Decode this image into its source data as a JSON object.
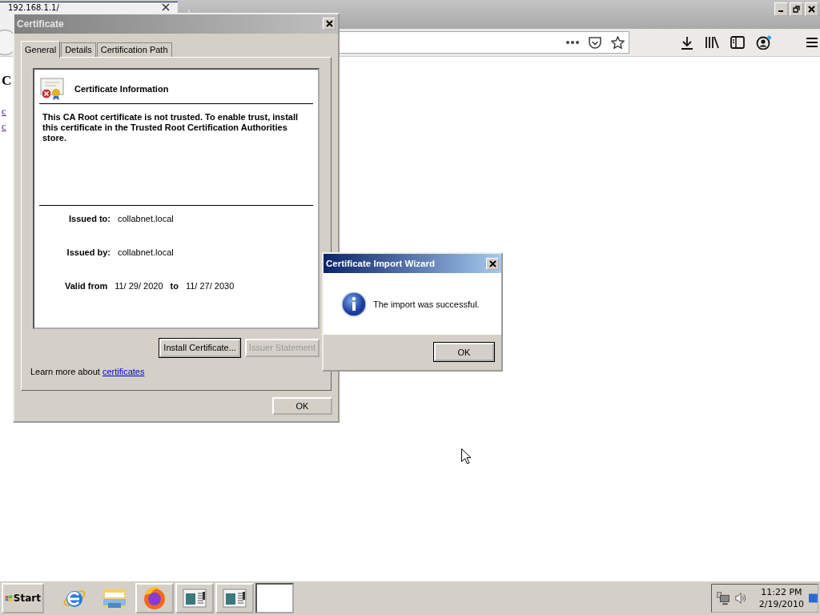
{
  "browser": {
    "tab": {
      "title": "192.168.1.1/"
    },
    "page": {
      "heading": "C",
      "links": [
        "c",
        "c"
      ]
    }
  },
  "certificate_dialog": {
    "title": "Certificate",
    "tabs": [
      {
        "label": "General",
        "selected": true
      },
      {
        "label": "Details",
        "selected": false
      },
      {
        "label": "Certification Path",
        "selected": false
      }
    ],
    "info_title": "Certificate Information",
    "message": "This CA Root certificate is not trusted. To enable trust, install this certificate in the Trusted Root Certification Authorities store.",
    "fields": [
      {
        "label": "Issued to:",
        "value": "collabnet.local"
      },
      {
        "label": "Issued by:",
        "value": "collabnet.local"
      }
    ],
    "validity": {
      "label": "Valid from",
      "from": "11/ 29/ 2020",
      "to_label": "to",
      "to": "11/ 27/ 2030"
    },
    "buttons": [
      {
        "label": "Install Certificate...",
        "disabled": false
      },
      {
        "label": "Issuer Statement",
        "disabled": true
      }
    ],
    "learn_more": {
      "text": "Learn more about",
      "link": "certificates"
    },
    "ok": "OK"
  },
  "wizard_dialog": {
    "title": "Certificate Import Wizard",
    "message": "The import was successful.",
    "ok": "OK"
  },
  "taskbar": {
    "start": "Start",
    "apps": [
      {
        "kind": "ie",
        "open": false
      },
      {
        "kind": "explorer",
        "open": false
      },
      {
        "kind": "firefox",
        "open": true
      },
      {
        "kind": "window",
        "open": true
      },
      {
        "kind": "window",
        "open": true
      },
      {
        "kind": "blank",
        "open": true
      }
    ],
    "clock": {
      "time": "11:22 PM",
      "date": "2/19/2010"
    }
  }
}
